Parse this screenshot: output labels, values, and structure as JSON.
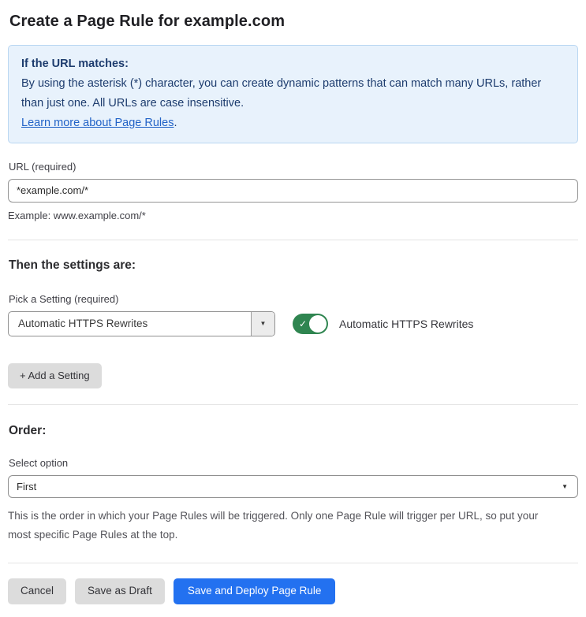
{
  "page": {
    "title": "Create a Page Rule for example.com"
  },
  "info_box": {
    "heading": "If the URL matches:",
    "body": "By using the asterisk (*) character, you can create dynamic patterns that can match many URLs, rather than just one. All URLs are case insensitive.",
    "link_label": "Learn more about Page Rules",
    "link_suffix": "."
  },
  "url_section": {
    "label": "URL (required)",
    "value": "*example.com/*",
    "example": "Example: www.example.com/*"
  },
  "settings_section": {
    "heading": "Then the settings are:",
    "picker_label": "Pick a Setting (required)",
    "picker_value": "Automatic HTTPS Rewrites",
    "toggle_state": "on",
    "toggle_label": "Automatic HTTPS Rewrites",
    "add_setting_label": "+ Add a Setting"
  },
  "order_section": {
    "heading": "Order:",
    "select_label": "Select option",
    "select_value": "First",
    "help_text": "This is the order in which your Page Rules will be triggered. Only one Page Rule will trigger per URL, so put your most specific Page Rules at the top."
  },
  "footer": {
    "cancel_label": "Cancel",
    "save_draft_label": "Save as Draft",
    "save_deploy_label": "Save and Deploy Page Rule"
  },
  "icons": {
    "dropdown_caret": "▼",
    "toggle_check": "✓"
  },
  "colors": {
    "info_bg": "#e8f2fc",
    "info_border": "#b9d6f2",
    "info_text": "#1d3c6e",
    "link_blue": "#2263c7",
    "toggle_on_green": "#2f8550",
    "primary_button_blue": "#2371f0",
    "secondary_button_gray": "#dcdcdc"
  }
}
